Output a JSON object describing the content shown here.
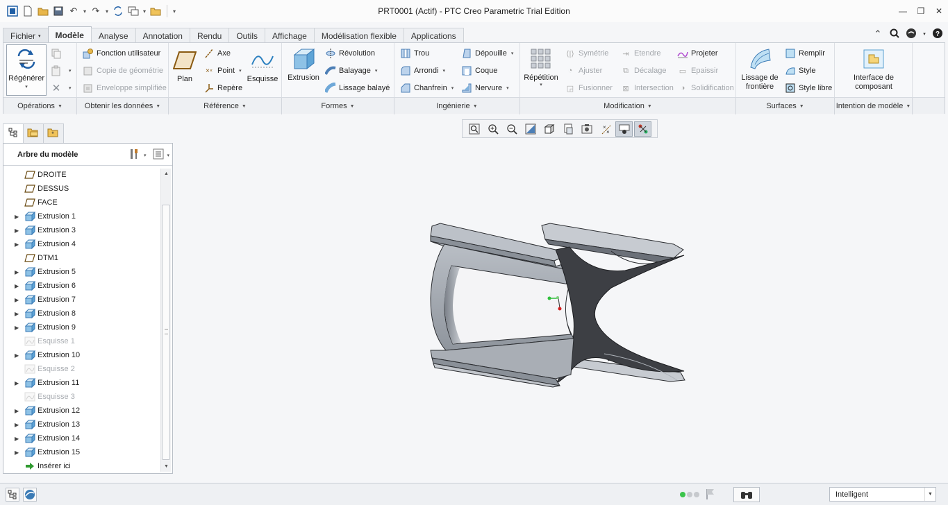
{
  "window": {
    "title": "PRT0001 (Actif) - PTC Creo Parametric Trial Edition"
  },
  "tabs": [
    {
      "label": "Fichier",
      "has_dropdown": true
    },
    {
      "label": "Modèle",
      "active": true
    },
    {
      "label": "Analyse"
    },
    {
      "label": "Annotation"
    },
    {
      "label": "Rendu"
    },
    {
      "label": "Outils"
    },
    {
      "label": "Affichage"
    },
    {
      "label": "Modélisation flexible"
    },
    {
      "label": "Applications"
    }
  ],
  "ribbon": {
    "operations": {
      "regenerate": "Régénérer",
      "footer": "Opérations"
    },
    "get_data": {
      "user_feature": "Fonction utilisateur",
      "copy_geometry": "Copie de géométrie",
      "shrinkwrap": "Enveloppe simplifiée",
      "footer": "Obtenir les données"
    },
    "datum": {
      "plane": "Plan",
      "axis": "Axe",
      "point": "Point",
      "csys": "Repère",
      "sketch": "Esquisse",
      "footer": "Référence"
    },
    "shapes": {
      "extrude": "Extrusion",
      "revolve": "Révolution",
      "sweep": "Balayage",
      "swept_blend": "Lissage balayé",
      "footer": "Formes"
    },
    "engineering": {
      "hole": "Trou",
      "round": "Arrondi",
      "chamfer": "Chanfrein",
      "draft": "Dépouille",
      "shell": "Coque",
      "rib": "Nervure",
      "footer": "Ingénierie"
    },
    "editing": {
      "pattern": "Répétition",
      "mirror": "Symétrie",
      "trim": "Ajuster",
      "merge": "Fusionner",
      "extend": "Etendre",
      "offset": "Décalage",
      "intersect": "Intersection",
      "project": "Projeter",
      "thicken": "Epaissir",
      "solidify": "Solidification",
      "footer": "Modification"
    },
    "surfaces": {
      "boundary_blend_line1": "Lissage de",
      "boundary_blend_line2": "frontière",
      "fill": "Remplir",
      "style": "Style",
      "freestyle": "Style libre",
      "footer": "Surfaces"
    },
    "design_intent": {
      "component_interface_line1": "Interface de",
      "component_interface_line2": "composant",
      "footer": "Intention de modèle"
    }
  },
  "model_tree": {
    "title": "Arbre du modèle",
    "items": [
      {
        "label": "DROITE",
        "icon": "plane-icon",
        "expandable": false,
        "disabled": false
      },
      {
        "label": "DESSUS",
        "icon": "plane-icon",
        "expandable": false,
        "disabled": false
      },
      {
        "label": "FACE",
        "icon": "plane-icon",
        "expandable": false,
        "disabled": false
      },
      {
        "label": "Extrusion 1",
        "icon": "extrude-icon",
        "expandable": true,
        "disabled": false
      },
      {
        "label": "Extrusion 3",
        "icon": "extrude-icon",
        "expandable": true,
        "disabled": false
      },
      {
        "label": "Extrusion 4",
        "icon": "extrude-icon",
        "expandable": true,
        "disabled": false
      },
      {
        "label": "DTM1",
        "icon": "plane-icon",
        "expandable": false,
        "disabled": false
      },
      {
        "label": "Extrusion 5",
        "icon": "extrude-icon",
        "expandable": true,
        "disabled": false
      },
      {
        "label": "Extrusion 6",
        "icon": "extrude-icon",
        "expandable": true,
        "disabled": false
      },
      {
        "label": "Extrusion 7",
        "icon": "extrude-icon",
        "expandable": true,
        "disabled": false
      },
      {
        "label": "Extrusion 8",
        "icon": "extrude-icon",
        "expandable": true,
        "disabled": false
      },
      {
        "label": "Extrusion 9",
        "icon": "extrude-icon",
        "expandable": true,
        "disabled": false
      },
      {
        "label": "Esquisse 1",
        "icon": "sketch-icon",
        "expandable": false,
        "disabled": true
      },
      {
        "label": "Extrusion 10",
        "icon": "extrude-icon",
        "expandable": true,
        "disabled": false
      },
      {
        "label": "Esquisse 2",
        "icon": "sketch-icon",
        "expandable": false,
        "disabled": true
      },
      {
        "label": "Extrusion 11",
        "icon": "extrude-icon",
        "expandable": true,
        "disabled": false
      },
      {
        "label": "Esquisse 3",
        "icon": "sketch-icon",
        "expandable": false,
        "disabled": true
      },
      {
        "label": "Extrusion 12",
        "icon": "extrude-icon",
        "expandable": true,
        "disabled": false
      },
      {
        "label": "Extrusion 13",
        "icon": "extrude-icon",
        "expandable": true,
        "disabled": false
      },
      {
        "label": "Extrusion 14",
        "icon": "extrude-icon",
        "expandable": true,
        "disabled": false
      },
      {
        "label": "Extrusion 15",
        "icon": "extrude-icon",
        "expandable": true,
        "disabled": false
      },
      {
        "label": "Insérer ici",
        "icon": "insert-arrow-icon",
        "expandable": false,
        "disabled": false
      }
    ]
  },
  "statusbar": {
    "selection_filter": "Intelligent"
  },
  "colors": {
    "part_light": "#9da3ab",
    "part_dark": "#3a3c40",
    "insert_arrow": "#2f9a2f"
  }
}
